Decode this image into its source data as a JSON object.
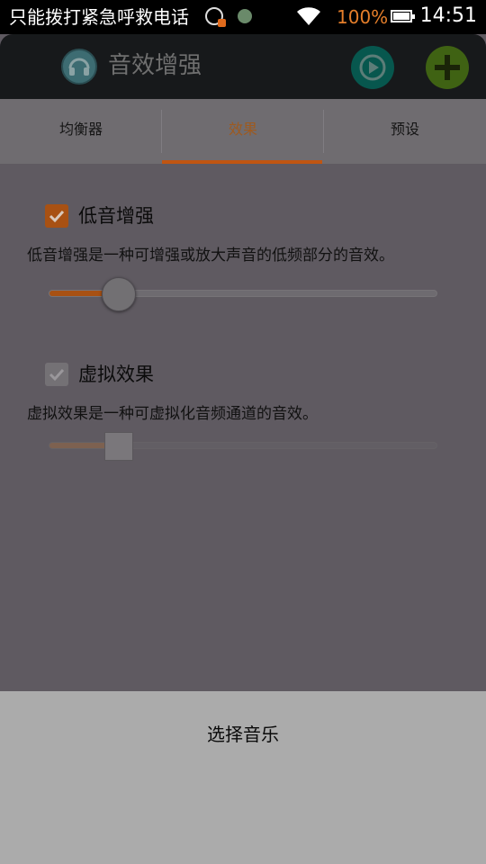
{
  "status_bar": {
    "text": "只能拨打紧急呼救电话",
    "battery_pct": "100%",
    "time": "14:51"
  },
  "action_bar": {
    "title": "音效增强",
    "icons": [
      "app-headphone-icon",
      "play-icon",
      "add-icon"
    ]
  },
  "tabs": [
    {
      "label": "均衡器",
      "active": false
    },
    {
      "label": "效果",
      "active": true
    },
    {
      "label": "预设",
      "active": false
    }
  ],
  "effects": [
    {
      "label": "低音增强",
      "checked": true,
      "enabled": true,
      "description": "低音增强是一种可增强或放大声音的低频部分的音效。",
      "slider_value": 0.18
    },
    {
      "label": "虚拟效果",
      "checked": true,
      "enabled": false,
      "description": "虚拟效果是一种可虚拟化音频通道的音效。",
      "slider_value": 0.18
    }
  ],
  "sheet": {
    "button_label": "选择音乐"
  },
  "colors": {
    "accent": "#c05512",
    "overlay_bg": "#5f5a61",
    "sheet_bg": "#ababab"
  }
}
